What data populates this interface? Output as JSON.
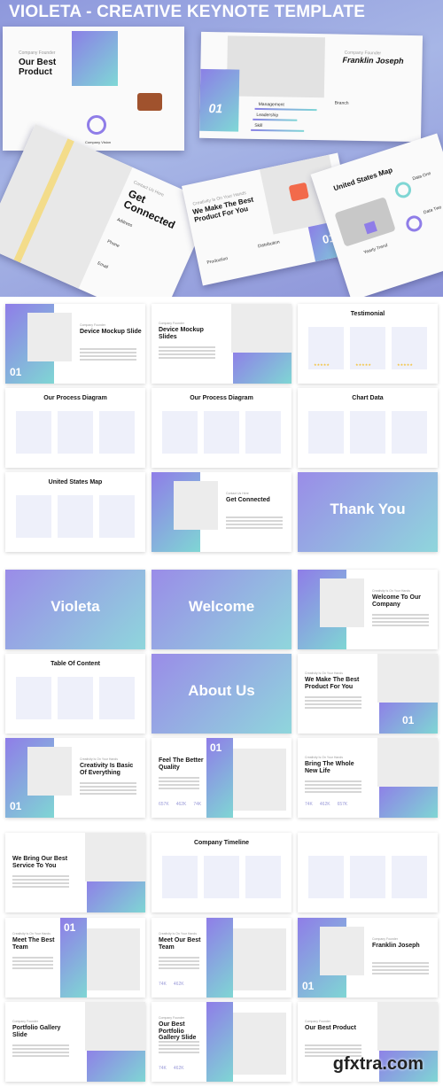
{
  "header": {
    "title": "VIOLETA - CREATIVE KEYNOTE TEMPLATE"
  },
  "hero_cards": [
    {
      "kicker": "Company Founder",
      "title": "Our Best Product",
      "extra": "Company Vision"
    },
    {
      "kicker": "Company Founder",
      "title": "Franklin Joseph",
      "big": "01",
      "skills": [
        "Management",
        "Leadership",
        "Skill"
      ],
      "extra": "Branch"
    },
    {
      "kicker": "Contact Us Here",
      "title": "Get Connected",
      "fields": [
        "Address",
        "Phone",
        "Email"
      ]
    },
    {
      "kicker": "Creativity Is On Your Hands",
      "title": "We Make The Best Product For You",
      "big": "01",
      "fields": [
        "Production",
        "Distribution"
      ]
    },
    {
      "title": "United States Map",
      "fields": [
        "Data One",
        "Data Two",
        "Yearly Trend"
      ]
    }
  ],
  "slides": [
    {
      "kicker": "Company Founder",
      "title": "Device Mockup Slide",
      "big": "01"
    },
    {
      "kicker": "Company Founder",
      "title": "Device Mockup Slides"
    },
    {
      "title": "Testimonial",
      "stars": "★★★★★"
    },
    {
      "title": "Our Process Diagram"
    },
    {
      "title": "Our Process Diagram"
    },
    {
      "title": "Chart Data"
    },
    {
      "title": "United States Map"
    },
    {
      "kicker": "Contact Us Here",
      "title": "Get Connected"
    },
    {
      "title": "Thank You"
    },
    {
      "title": "Violeta"
    },
    {
      "title": "Welcome"
    },
    {
      "kicker": "Creativity Is On Your Hands",
      "title": "Welcome To Our Company"
    },
    {
      "title": "Table Of Content"
    },
    {
      "title": "About Us"
    },
    {
      "kicker": "Creativity Is On Your Hands",
      "title": "We Make The Best Product For You",
      "big": "01"
    },
    {
      "kicker": "Creativity Is On Your Hands",
      "title": "Creativity Is Basic Of Everything",
      "big": "01"
    },
    {
      "title": "Feel The Better Quality",
      "big": "01",
      "stats": [
        "657K",
        "462K",
        "74K"
      ]
    },
    {
      "kicker": "Creativity Is On Your Hands",
      "title": "Bring The Whole New Life",
      "stats": [
        "74K",
        "462K",
        "657K"
      ]
    },
    {
      "title": "We Bring Our Best Service To You"
    },
    {
      "title": "Company Timeline"
    },
    {
      "title": ""
    },
    {
      "kicker": "Creativity Is On Your Hands",
      "title": "Meet The Best Team",
      "big": "01"
    },
    {
      "kicker": "Creativity Is On Your Hands",
      "title": "Meet Our Best Team",
      "stats": [
        "74K",
        "462K"
      ]
    },
    {
      "kicker": "Company Founder",
      "title": "Franklin Joseph",
      "big": "01"
    },
    {
      "kicker": "Company Founder",
      "title": "Portfolio Gallery Slide"
    },
    {
      "kicker": "Company Founder",
      "title": "Our Best Portfolio Gallery Slide",
      "stats": [
        "74K",
        "462K"
      ]
    },
    {
      "kicker": "Company Founder",
      "title": "Our Best Product"
    }
  ],
  "watermark": "gfxtra.com",
  "colors": {
    "accent_purple": "#8f7de8",
    "accent_teal": "#7fd6d4",
    "hero_bg": "#9aa6e2"
  }
}
